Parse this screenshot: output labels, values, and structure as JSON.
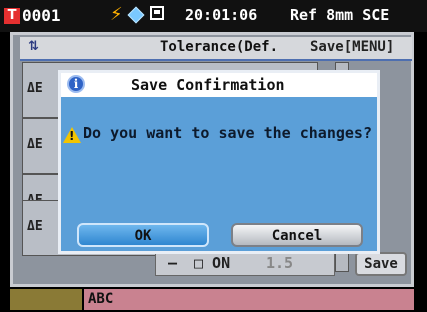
{
  "status": {
    "sample_no": "0001",
    "t_badge": "T",
    "time": "20:01:06",
    "measurement": "Ref 8mm SCE"
  },
  "background": {
    "title": "Tolerance(Def.",
    "menu": "Save[MENU]",
    "row_label": "ΔE",
    "bottom_minus": "–",
    "bottom_on": "□ ON",
    "bottom_value": "1.5",
    "save_label": "Save"
  },
  "dialog": {
    "title": "Save Confirmation",
    "message": "Do you want to save the changes?",
    "ok": "OK",
    "cancel": "Cancel"
  },
  "bottom": {
    "name": "ABC"
  },
  "icons": {
    "info": "i",
    "warning": "!"
  }
}
